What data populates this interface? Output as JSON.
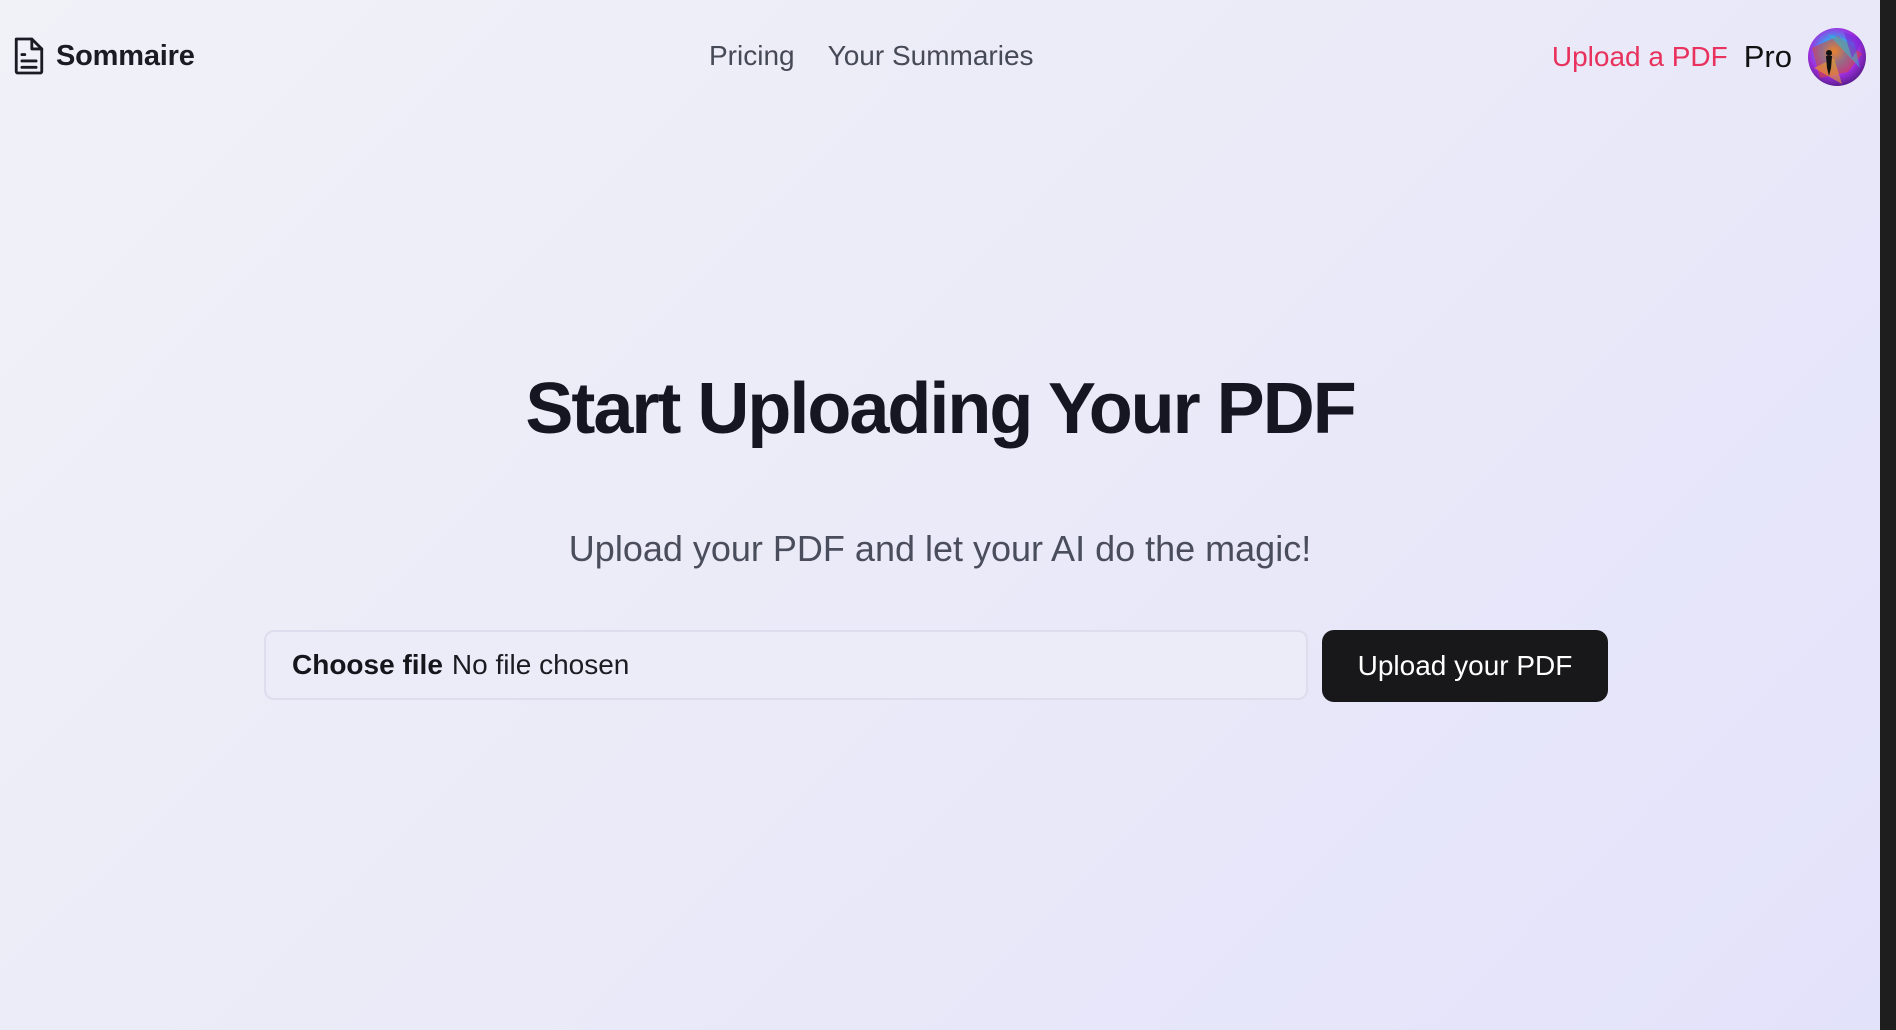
{
  "header": {
    "brand_name": "Sommaire",
    "brand_icon": "document-icon",
    "nav": [
      {
        "label": "Pricing"
      },
      {
        "label": "Your Summaries"
      }
    ],
    "upload_link": "Upload a PDF",
    "plan_badge": "Pro",
    "avatar_icon": "user-avatar"
  },
  "main": {
    "title": "Start Uploading Your PDF",
    "subtitle": "Upload your PDF and let your AI do the magic!",
    "file_input": {
      "button_label": "Choose file",
      "status": "No file chosen"
    },
    "submit_label": "Upload your PDF"
  },
  "colors": {
    "accent": "#e8315c",
    "primary_button": "#18181b",
    "background": "#ebebf8"
  }
}
